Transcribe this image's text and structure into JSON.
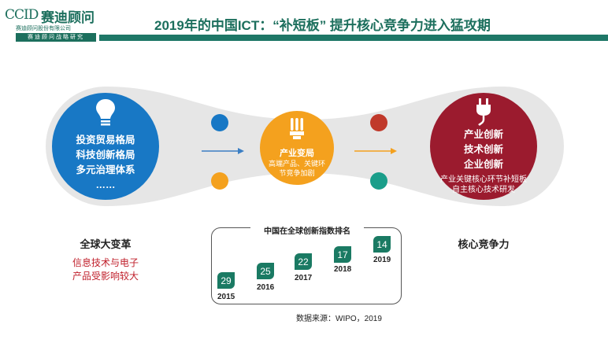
{
  "logo": {
    "latin": "CCID",
    "chinese": "赛迪顾问",
    "subtitle": "赛迪顾问股份有限公司",
    "bar_text": "赛迪顾问战略研究"
  },
  "title": "2019年的中国ICT：“补短板” 提升核心竞争力进入猛攻期",
  "left": {
    "lines": [
      "投资贸易格局",
      "科技创新格局",
      "多元治理体系",
      "……"
    ],
    "label": "全球大变革",
    "sublabel": [
      "信息技术与电子",
      "产品受影响较大"
    ]
  },
  "middle": {
    "title": "产业变局",
    "sub": [
      "高端产品、关键环",
      "节竞争加剧"
    ]
  },
  "right": {
    "lines": [
      "产业创新",
      "技术创新",
      "企业创新"
    ],
    "small": [
      "产业关键核心环节补短板",
      "自主核心技术研发"
    ],
    "label": "核心竞争力"
  },
  "ranking": {
    "title": "中国在全球创新指数排名",
    "items": [
      {
        "year": "2015",
        "rank": "29"
      },
      {
        "year": "2016",
        "rank": "25"
      },
      {
        "year": "2017",
        "rank": "22"
      },
      {
        "year": "2018",
        "rank": "17"
      },
      {
        "year": "2019",
        "rank": "14"
      }
    ]
  },
  "source": "数据来源：WIPO，2019",
  "colors": {
    "brand": "#1e7767",
    "blue": "#1878c5",
    "orange": "#f4a11e",
    "red": "#9b1b2e",
    "teal": "#1a9e8a",
    "band": "#e6e6e6"
  },
  "icons": [
    "lightbulb-icon",
    "cfl-bulb-icon",
    "power-plug-icon",
    "arrow-right-icon"
  ]
}
